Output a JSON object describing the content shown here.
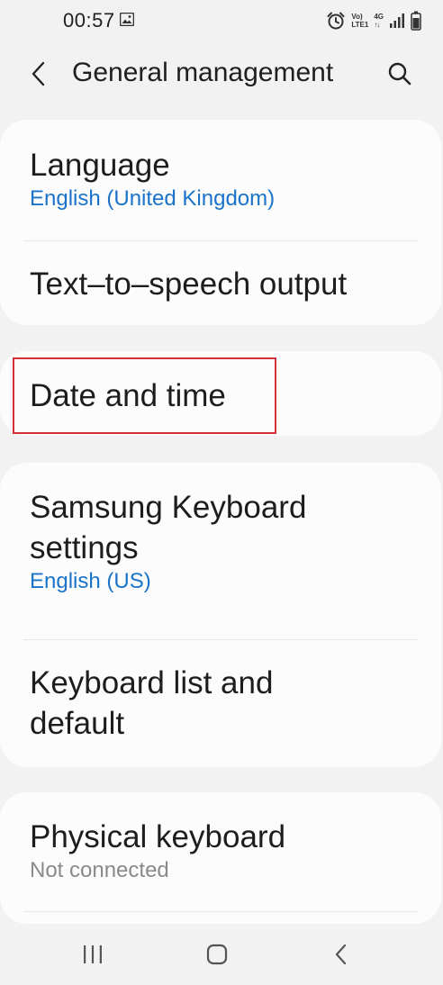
{
  "status_bar": {
    "time": "00:57",
    "net_top": "Vo)",
    "net_bottom": "LTE1",
    "net_type": "4G"
  },
  "header": {
    "title": "General management"
  },
  "items": {
    "language": {
      "title": "Language",
      "subtitle": "English (United Kingdom)"
    },
    "tts": {
      "title": "Text–to–speech output"
    },
    "date_time": {
      "title": "Date and time"
    },
    "samsung_keyboard": {
      "title_line1": "Samsung Keyboard",
      "title_line2": "settings",
      "subtitle": "English (US)"
    },
    "keyboard_list": {
      "title_line1": "Keyboard list and",
      "title_line2": "default"
    },
    "physical_keyboard": {
      "title": "Physical keyboard",
      "subtitle": "Not connected"
    }
  },
  "colors": {
    "accent_blue": "#1a73c9",
    "highlight_red": "#d32f3a",
    "background": "#f2f2f2",
    "card": "#fcfcfc"
  },
  "icons": {
    "back": "chevron-left-icon",
    "search": "search-icon",
    "alarm": "alarm-icon",
    "signal": "signal-icon",
    "battery": "battery-icon",
    "gallery": "gallery-icon",
    "nav_recents": "recents-icon",
    "nav_home": "home-icon",
    "nav_back": "back-icon"
  }
}
